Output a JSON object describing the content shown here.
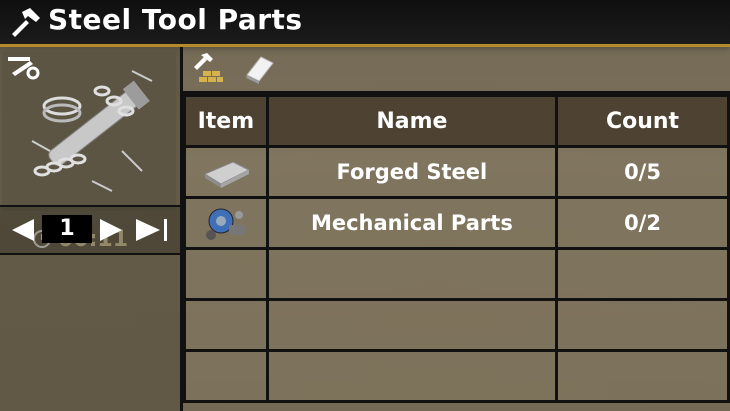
{
  "window": {
    "title": "Steel Tool Parts"
  },
  "recipe": {
    "time": "00:11"
  },
  "pager": {
    "page": "1"
  },
  "table": {
    "headers": {
      "item": "Item",
      "name": "Name",
      "count": "Count"
    },
    "rows": [
      {
        "name": "Forged Steel",
        "count": "0/5",
        "icon": "forged-steel-icon"
      },
      {
        "name": "Mechanical Parts",
        "count": "0/2",
        "icon": "mechanical-parts-icon"
      },
      {
        "name": "",
        "count": ""
      },
      {
        "name": "",
        "count": ""
      },
      {
        "name": "",
        "count": ""
      }
    ]
  },
  "colors": {
    "accent": "#b58a2a",
    "title_bg": "#141414",
    "border": "#111111"
  }
}
